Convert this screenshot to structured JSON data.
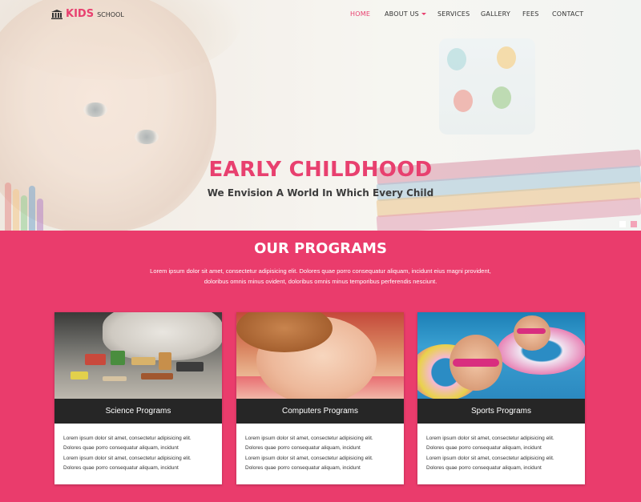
{
  "brand": {
    "name_bold": "KIDS",
    "name_small": "SCHOOL"
  },
  "nav": {
    "items": [
      {
        "label": "HOME",
        "active": true
      },
      {
        "label": "ABOUT US",
        "dropdown": true
      },
      {
        "label": "SERVICES"
      },
      {
        "label": "GALLERY"
      },
      {
        "label": "FEES"
      },
      {
        "label": "CONTACT"
      }
    ]
  },
  "hero": {
    "title": "EARLY CHILDHOOD",
    "subtitle": "We Envision A World In Which Every Child",
    "slides": 2,
    "active_slide": 2
  },
  "programs": {
    "title": "OUR PROGRAMS",
    "description_line1": "Lorem ipsum dolor sit amet, consectetur adipisicing elit. Dolores quae porro consequatur aliquam, incidunt eius magni provident,",
    "description_line2": "doloribus omnis minus ovident, doloribus omnis minus temporibus perferendis nesciunt.",
    "cards": [
      {
        "label": "Science Programs",
        "lines": [
          "Lorem ipsum dolor sit amet, consectetur adipisicing elit.",
          "Dolores quae porro consequatur aliquam, incidunt",
          "Lorem ipsum dolor sit amet, consectetur adipisicing elit.",
          "Dolores quae porro consequatur aliquam, incidunt"
        ]
      },
      {
        "label": "Computers Programs",
        "lines": [
          "Lorem ipsum dolor sit amet, consectetur adipisicing elit.",
          "Dolores quae porro consequatur aliquam, incidunt",
          "Lorem ipsum dolor sit amet, consectetur adipisicing elit.",
          "Dolores quae porro consequatur aliquam, incidunt"
        ]
      },
      {
        "label": "Sports Programs",
        "lines": [
          "Lorem ipsum dolor sit amet, consectetur adipisicing elit.",
          "Dolores quae porro consequatur aliquam, incidunt",
          "Lorem ipsum dolor sit amet, consectetur adipisicing elit.",
          "Dolores quae porro consequatur aliquam, incidunt"
        ]
      }
    ]
  },
  "colors": {
    "accent": "#e8406f",
    "section_bg": "#ea3c6c",
    "card_bar": "#262626"
  },
  "icons": {
    "logo": "school-building-icon",
    "dropdown": "caret-down-icon"
  }
}
